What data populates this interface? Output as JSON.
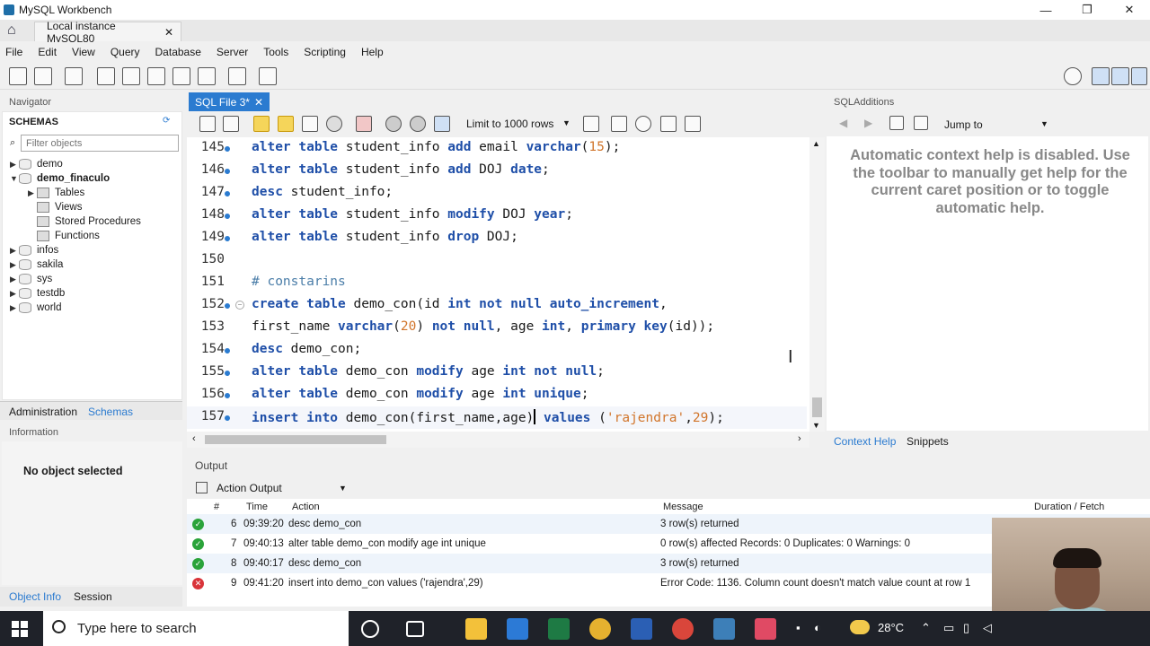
{
  "window": {
    "title": "MySQL Workbench",
    "min": "—",
    "max": "❐",
    "close": "✕"
  },
  "connection_tab": {
    "label": "Local instance MySQL80",
    "close": "✕"
  },
  "menu": [
    "File",
    "Edit",
    "View",
    "Query",
    "Database",
    "Server",
    "Tools",
    "Scripting",
    "Help"
  ],
  "navigator": {
    "header": "Navigator",
    "schemas_label": "SCHEMAS",
    "filter_placeholder": "Filter objects",
    "tree": [
      {
        "label": "demo",
        "expanded": false,
        "bold": false
      },
      {
        "label": "demo_finaculo",
        "expanded": true,
        "bold": true
      },
      {
        "label": "Tables",
        "child": true
      },
      {
        "label": "Views",
        "child": true
      },
      {
        "label": "Stored Procedures",
        "child": true
      },
      {
        "label": "Functions",
        "child": true
      },
      {
        "label": "infos",
        "expanded": false,
        "bold": false
      },
      {
        "label": "sakila",
        "expanded": false,
        "bold": false
      },
      {
        "label": "sys",
        "expanded": false,
        "bold": false
      },
      {
        "label": "testdb",
        "expanded": false,
        "bold": false
      },
      {
        "label": "world",
        "expanded": false,
        "bold": false
      }
    ],
    "tabs": [
      "Administration",
      "Schemas"
    ],
    "info_header": "Information",
    "no_object": "No object selected",
    "bottom_tabs": [
      "Object Info",
      "Session"
    ]
  },
  "editor": {
    "tab_label": "SQL File 3*",
    "tab_close": "✕",
    "limit_label": "Limit to 1000 rows",
    "lines": [
      {
        "n": "145",
        "code": "alter table student_info add email varchar(15);"
      },
      {
        "n": "146",
        "code": "alter table student_info add DOJ date;"
      },
      {
        "n": "147",
        "code": "desc student_info;"
      },
      {
        "n": "148",
        "code": "alter table student_info modify DOJ year;"
      },
      {
        "n": "149",
        "code": "alter table student_info drop DOJ;"
      },
      {
        "n": "150",
        "code": ""
      },
      {
        "n": "151",
        "code": "# constarins"
      },
      {
        "n": "152",
        "code": "create table demo_con(id int not null auto_increment,"
      },
      {
        "n": "153",
        "code": "first_name varchar(20) not null, age int, primary key(id));"
      },
      {
        "n": "154",
        "code": "desc demo_con;"
      },
      {
        "n": "155",
        "code": "alter table demo_con modify age int not null;"
      },
      {
        "n": "156",
        "code": "alter table demo_con modify age int unique;"
      },
      {
        "n": "157",
        "code": "insert into demo_con(first_name,age) values ('rajendra',29);"
      }
    ]
  },
  "sql_additions": {
    "header": "SQLAdditions",
    "jump_to": "Jump to",
    "help_text": "Automatic context help is disabled. Use the toolbar to manually get help for the current caret position or to toggle automatic help.",
    "tabs": [
      "Context Help",
      "Snippets"
    ]
  },
  "output": {
    "header": "Output",
    "selector": "Action Output",
    "columns": [
      "#",
      "Time",
      "Action",
      "Message",
      "Duration / Fetch"
    ],
    "rows": [
      {
        "status": "ok",
        "num": "6",
        "time": "09:39:20",
        "action": "desc demo_con",
        "message": "3 row(s) returned"
      },
      {
        "status": "ok",
        "num": "7",
        "time": "09:40:13",
        "action": "alter table demo_con modify age int unique",
        "message": "0 row(s) affected Records: 0  Duplicates: 0  Warnings: 0"
      },
      {
        "status": "ok",
        "num": "8",
        "time": "09:40:17",
        "action": "desc demo_con",
        "message": "3 row(s) returned"
      },
      {
        "status": "error",
        "num": "9",
        "time": "09:41:20",
        "action": "insert into demo_con values ('rajendra',29)",
        "message": "Error Code: 1136. Column count doesn't match value count at row 1"
      }
    ]
  },
  "taskbar": {
    "search_placeholder": "Type here to search",
    "weather": "28°C"
  },
  "colors": {
    "accent": "#2b7bd0",
    "keyword": "#1f4fa8",
    "string": "#d1752b",
    "ok": "#2aa33a",
    "error": "#d9343a"
  }
}
